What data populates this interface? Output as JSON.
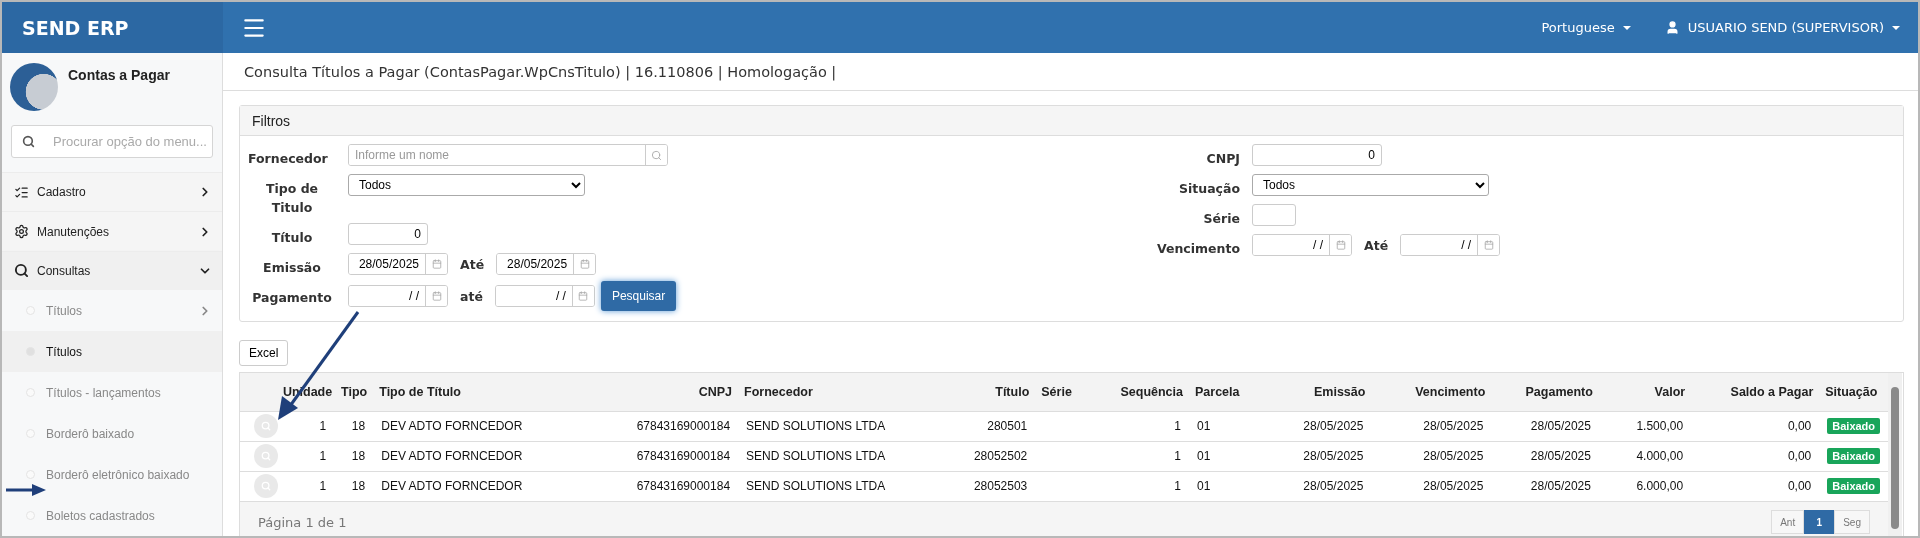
{
  "app_title": "SEND ERP",
  "topbar": {
    "language": "Portuguese",
    "user": "USUARIO SEND (SUPERVISOR)"
  },
  "sidebar": {
    "module": "Contas a Pagar",
    "search": {
      "placeholder": "Procurar opção do menu..."
    },
    "items": [
      {
        "label": "Cadastro",
        "kind": "list",
        "expanded": false
      },
      {
        "label": "Manutenções",
        "kind": "gears",
        "expanded": false
      },
      {
        "label": "Consultas",
        "kind": "search",
        "expanded": true,
        "children": [
          {
            "label": "Títulos",
            "has_children": true,
            "selected": false
          },
          {
            "label": "Títulos",
            "has_children": false,
            "selected": true
          },
          {
            "label": "Títulos - lançamentos",
            "has_children": false,
            "selected": false
          },
          {
            "label": "Borderô baixado",
            "has_children": false,
            "selected": false
          },
          {
            "label": "Borderô eletrônico baixado",
            "has_children": false,
            "selected": false
          },
          {
            "label": "Boletos cadastrados",
            "has_children": false,
            "selected": false
          }
        ]
      }
    ]
  },
  "page_title": "Consulta Títulos a Pagar (ContasPagar.WpCnsTitulo) | 16.110806 | Homologação |",
  "filters": {
    "title": "Filtros",
    "left": [
      {
        "label": "Fornecedor",
        "kind": "search",
        "placeholder": "Informe um nome"
      },
      {
        "label": "Tipo de Titulo",
        "kind": "select",
        "value": "Todos"
      },
      {
        "label": "Título",
        "kind": "number",
        "value": "0"
      },
      {
        "label": "Emissão",
        "kind": "date-range",
        "from": "28/05/2025",
        "to_label": "Até",
        "to": "28/05/2025"
      },
      {
        "label": "Pagamento",
        "kind": "date-range",
        "from": "/ /",
        "to_label": "até",
        "to": "/ /"
      }
    ],
    "right": [
      {
        "label": "CNPJ",
        "kind": "number",
        "value": "0"
      },
      {
        "label": "Situação",
        "kind": "select",
        "value": "Todos"
      },
      {
        "label": "Série",
        "kind": "text"
      },
      {
        "label": "Vencimento",
        "kind": "date-range",
        "from": "/ /",
        "to_label": "Até",
        "to": "/ /"
      }
    ],
    "search_button": "Pesquisar"
  },
  "excel_button": "Excel",
  "table": {
    "columns": [
      "",
      "Unidade",
      "Tipo",
      "Tipo de Título",
      "CNPJ",
      "Fornecedor",
      "Título",
      "Série",
      "Sequência",
      "Parcela",
      "Emissão",
      "Vencimento",
      "Pagamento",
      "Valor",
      "Saldo a Pagar",
      "Situação"
    ],
    "rows": [
      {
        "cells": [
          "",
          "1",
          "18",
          "DEV ADTO FORNCEDOR",
          "67843169000184",
          "SEND SOLUTIONS LTDA",
          "280501",
          "",
          "1",
          "01",
          "28/05/2025",
          "28/05/2025",
          "28/05/2025",
          "1.500,00",
          "0,00"
        ],
        "status": "Baixado"
      },
      {
        "cells": [
          "",
          "1",
          "18",
          "DEV ADTO FORNCEDOR",
          "67843169000184",
          "SEND SOLUTIONS LTDA",
          "28052502",
          "",
          "1",
          "01",
          "28/05/2025",
          "28/05/2025",
          "28/05/2025",
          "4.000,00",
          "0,00"
        ],
        "status": "Baixado"
      },
      {
        "cells": [
          "",
          "1",
          "18",
          "DEV ADTO FORNCEDOR",
          "67843169000184",
          "SEND SOLUTIONS LTDA",
          "28052503",
          "",
          "1",
          "01",
          "28/05/2025",
          "28/05/2025",
          "28/05/2025",
          "6.000,00",
          "0,00"
        ],
        "status": "Baixado"
      }
    ],
    "page_info": "Página 1 de 1",
    "pager": [
      {
        "label": "Ant",
        "selected": false
      },
      {
        "label": "1",
        "selected": true
      },
      {
        "label": "Seg",
        "selected": false
      }
    ]
  }
}
